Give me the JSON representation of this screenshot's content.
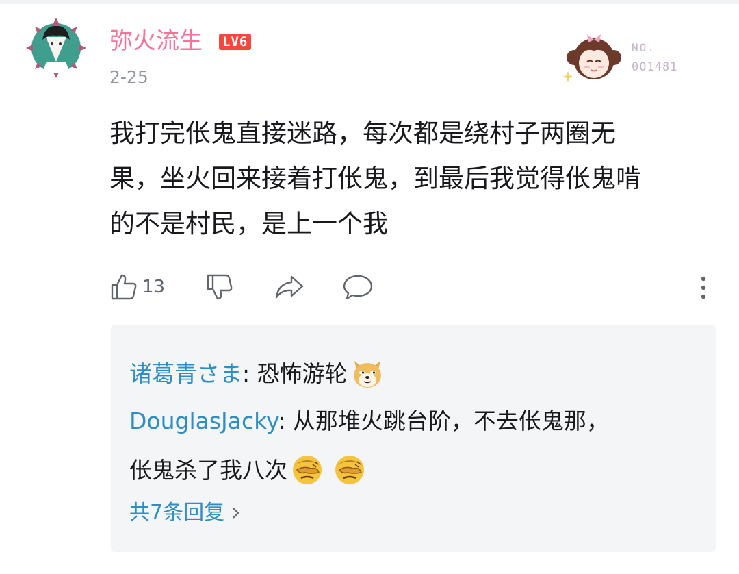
{
  "comment": {
    "username": "弥火流生",
    "level_badge": "LV6",
    "date": "2-25",
    "fan_badge": {
      "no_label": "NO.",
      "number": "001481"
    },
    "text": "我打完伥鬼直接迷路，每次都是绕村子两圈无果，坐火回来接着打伥鬼，到最后我觉得伥鬼啃的不是村民，是上一个我",
    "lines": [
      "我打完伥鬼直接迷路，每次都是绕村子两圈无",
      "果，坐火回来接着打伥鬼，到最后我觉得伥鬼啃",
      "的不是村民，是上一个我"
    ],
    "like_count": "13"
  },
  "replies": {
    "items": [
      {
        "name": "诸葛青さま",
        "sep": ": ",
        "text": "恐怖游轮",
        "emojis": [
          "doge-emoji"
        ]
      },
      {
        "name": "DouglasJacky",
        "sep": ": ",
        "text_line1": "从那堆火跳台阶，不去伥鬼那，",
        "text_line2": "伥鬼杀了我八次",
        "emojis": [
          "facepalm-emoji",
          "facepalm-emoji"
        ]
      }
    ],
    "more_label": "共7条回复"
  },
  "colors": {
    "username": "#fb7299",
    "level_badge": "#f5483c",
    "reply_name": "#2d8ec6",
    "reply_bg": "#f4f5f7",
    "meta_gray": "#9499a0"
  }
}
